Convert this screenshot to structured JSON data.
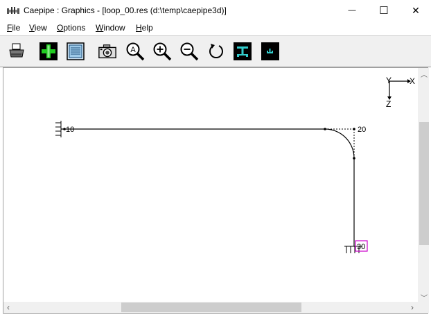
{
  "window": {
    "title": "Caepipe : Graphics -  [loop_00.res (d:\\temp\\caepipe3d)]",
    "minimize_glyph": "—",
    "maximize_glyph": "☐",
    "close_glyph": "✕"
  },
  "menu": {
    "items": [
      {
        "label_ul": "F",
        "label_rest": "ile"
      },
      {
        "label_ul": "V",
        "label_rest": "iew"
      },
      {
        "label_ul": "O",
        "label_rest": "ptions"
      },
      {
        "label_ul": "W",
        "label_rest": "indow"
      },
      {
        "label_ul": "H",
        "label_rest": "elp"
      }
    ]
  },
  "toolbar": {
    "icons": [
      "printer-icon",
      "add-element-icon",
      "list-view-icon",
      "camera-icon",
      "zoom-all-icon",
      "zoom-in-icon",
      "zoom-out-icon",
      "rotate-icon",
      "restraint-view-icon",
      "node-view-icon"
    ],
    "zoom_all_letter": "A"
  },
  "drawing": {
    "axis_y": "Y",
    "axis_x": "X",
    "axis_z": "Z",
    "nodes": [
      {
        "label": "10"
      },
      {
        "label": "20"
      },
      {
        "label": "30"
      }
    ]
  },
  "colors": {
    "toolbar_bg": "#f0f0f0",
    "pipe": "#000000",
    "node30_box": "#cc00cc"
  }
}
